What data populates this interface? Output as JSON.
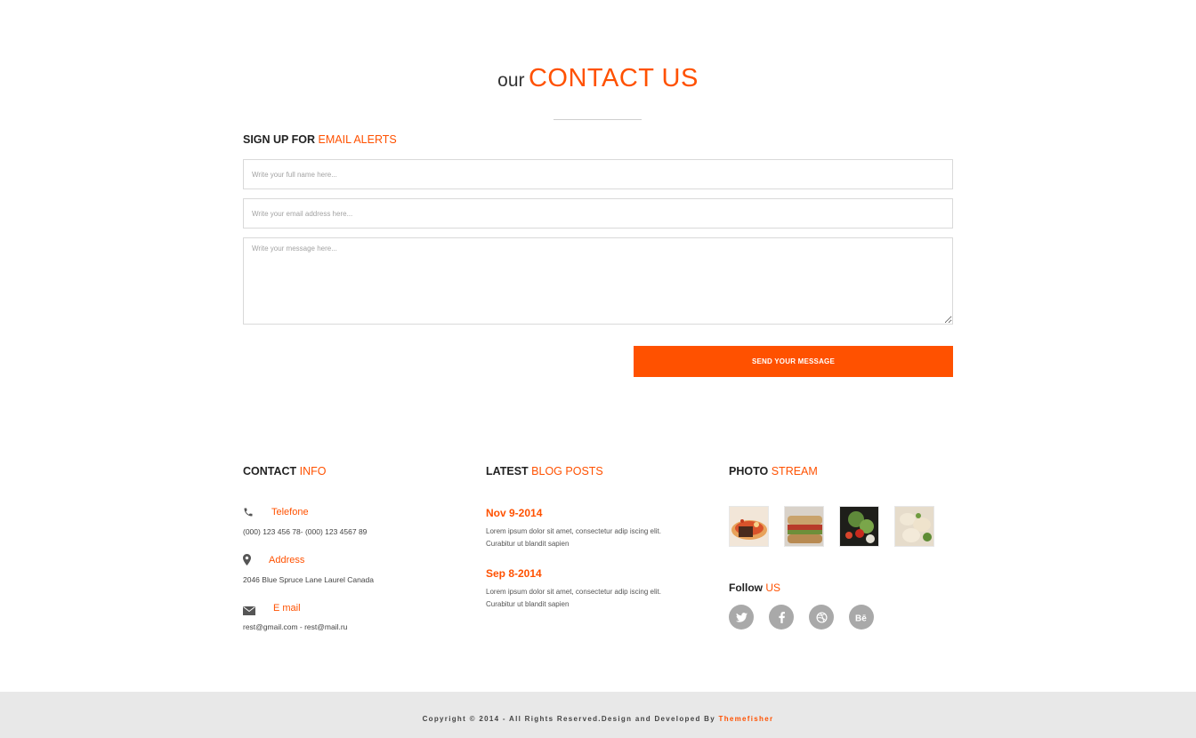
{
  "header": {
    "title_lead": "our",
    "title_accent": "CONTACT US"
  },
  "form": {
    "heading_lead": "SIGN UP FOR",
    "heading_accent": "EMAIL ALERTS",
    "name_placeholder": "Write your full name here...",
    "email_placeholder": "Write your email address here...",
    "message_placeholder": "Write your message here...",
    "send_label": "SEND YOUR MESSAGE"
  },
  "contact_info": {
    "heading_lead": "CONTACT",
    "heading_accent": "INFO",
    "items": [
      {
        "icon": "phone-icon",
        "label": "Telefone",
        "value": "(000) 123 456 78- (000) 123 4567 89"
      },
      {
        "icon": "map-marker-icon",
        "label": "Address",
        "value": "2046 Blue Spruce Lane Laurel Canada"
      },
      {
        "icon": "envelope-icon",
        "label": "E mail",
        "value": "rest@gmail.com - rest@mail.ru"
      }
    ]
  },
  "blog": {
    "heading_lead": "LATEST",
    "heading_accent": "BLOG POSTS",
    "posts": [
      {
        "date": "Nov 9-2014",
        "line1": "Lorem ipsum dolor sit amet, consectetur adip iscing elit.",
        "line2": "Curabitur ut blandit sapien"
      },
      {
        "date": "Sep 8-2014",
        "line1": "Lorem ipsum dolor sit amet, consectetur adip iscing elit.",
        "line2": "Curabitur ut blandit sapien"
      }
    ]
  },
  "photo_stream": {
    "heading_lead": "PHOTO",
    "heading_accent": "STREAM",
    "photos": [
      "pizza-photo",
      "sandwich-photo",
      "salad-photo",
      "dumplings-photo"
    ]
  },
  "follow": {
    "lead": "Follow",
    "accent": "US",
    "icons": [
      "twitter-icon",
      "facebook-icon",
      "dribbble-icon",
      "behance-icon"
    ]
  },
  "footer": {
    "copyright": "Copyright © 2014 - All Rights Reserved.Design and Developed By",
    "brand": "Themefisher"
  },
  "colors": {
    "accent": "#ff5100",
    "footer_bg": "#e8e8e8",
    "social_bg": "#a9a9a9"
  }
}
